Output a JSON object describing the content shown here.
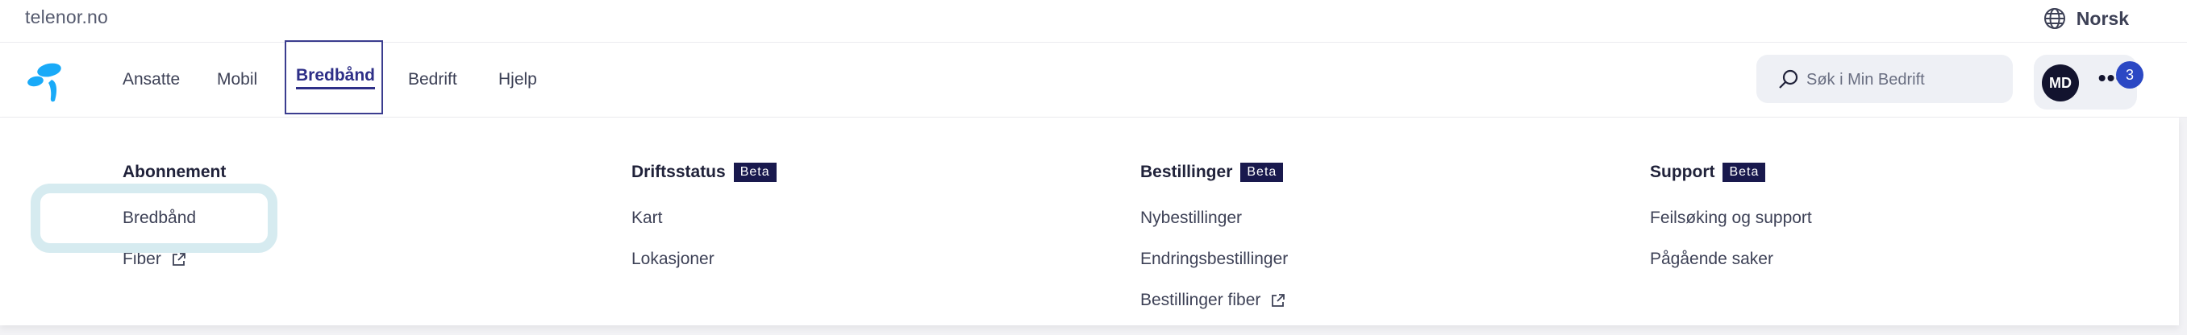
{
  "topbar": {
    "site": "telenor.no",
    "language": "Norsk",
    "language_icon": "globe-icon"
  },
  "nav": {
    "items": [
      {
        "label": "Ansatte"
      },
      {
        "label": "Mobil"
      },
      {
        "label": "Bredbånd",
        "active": true
      },
      {
        "label": "Bedrift"
      },
      {
        "label": "Hjelp"
      }
    ],
    "search": {
      "placeholder": "Søk i Min Bedrift",
      "value": ""
    },
    "user": {
      "initials": "MD",
      "more_label": "•••",
      "notification_count": "3"
    }
  },
  "menu": {
    "columns": [
      {
        "title": "Abonnement",
        "badge": "",
        "links": [
          {
            "label": "Bredbånd",
            "external": false
          },
          {
            "label": "Fiber",
            "external": true
          }
        ]
      },
      {
        "title": "Driftsstatus",
        "badge": "Beta",
        "links": [
          {
            "label": "Kart",
            "external": false
          },
          {
            "label": "Lokasjoner",
            "external": false
          }
        ]
      },
      {
        "title": "Bestillinger",
        "badge": "Beta",
        "links": [
          {
            "label": "Nybestillinger",
            "external": false
          },
          {
            "label": "Endringsbestillinger",
            "external": false
          },
          {
            "label": "Bestillinger fiber",
            "external": true
          }
        ]
      },
      {
        "title": "Support",
        "badge": "Beta",
        "links": [
          {
            "label": "Feilsøking og support",
            "external": false
          },
          {
            "label": "Pågående saker",
            "external": false
          }
        ]
      }
    ]
  },
  "colors": {
    "brand": "#19aaf8",
    "active_nav": "#2e2f87",
    "badge_bg": "#19194d",
    "notification": "#2b48c4",
    "highlight": "#d6ebf0"
  }
}
